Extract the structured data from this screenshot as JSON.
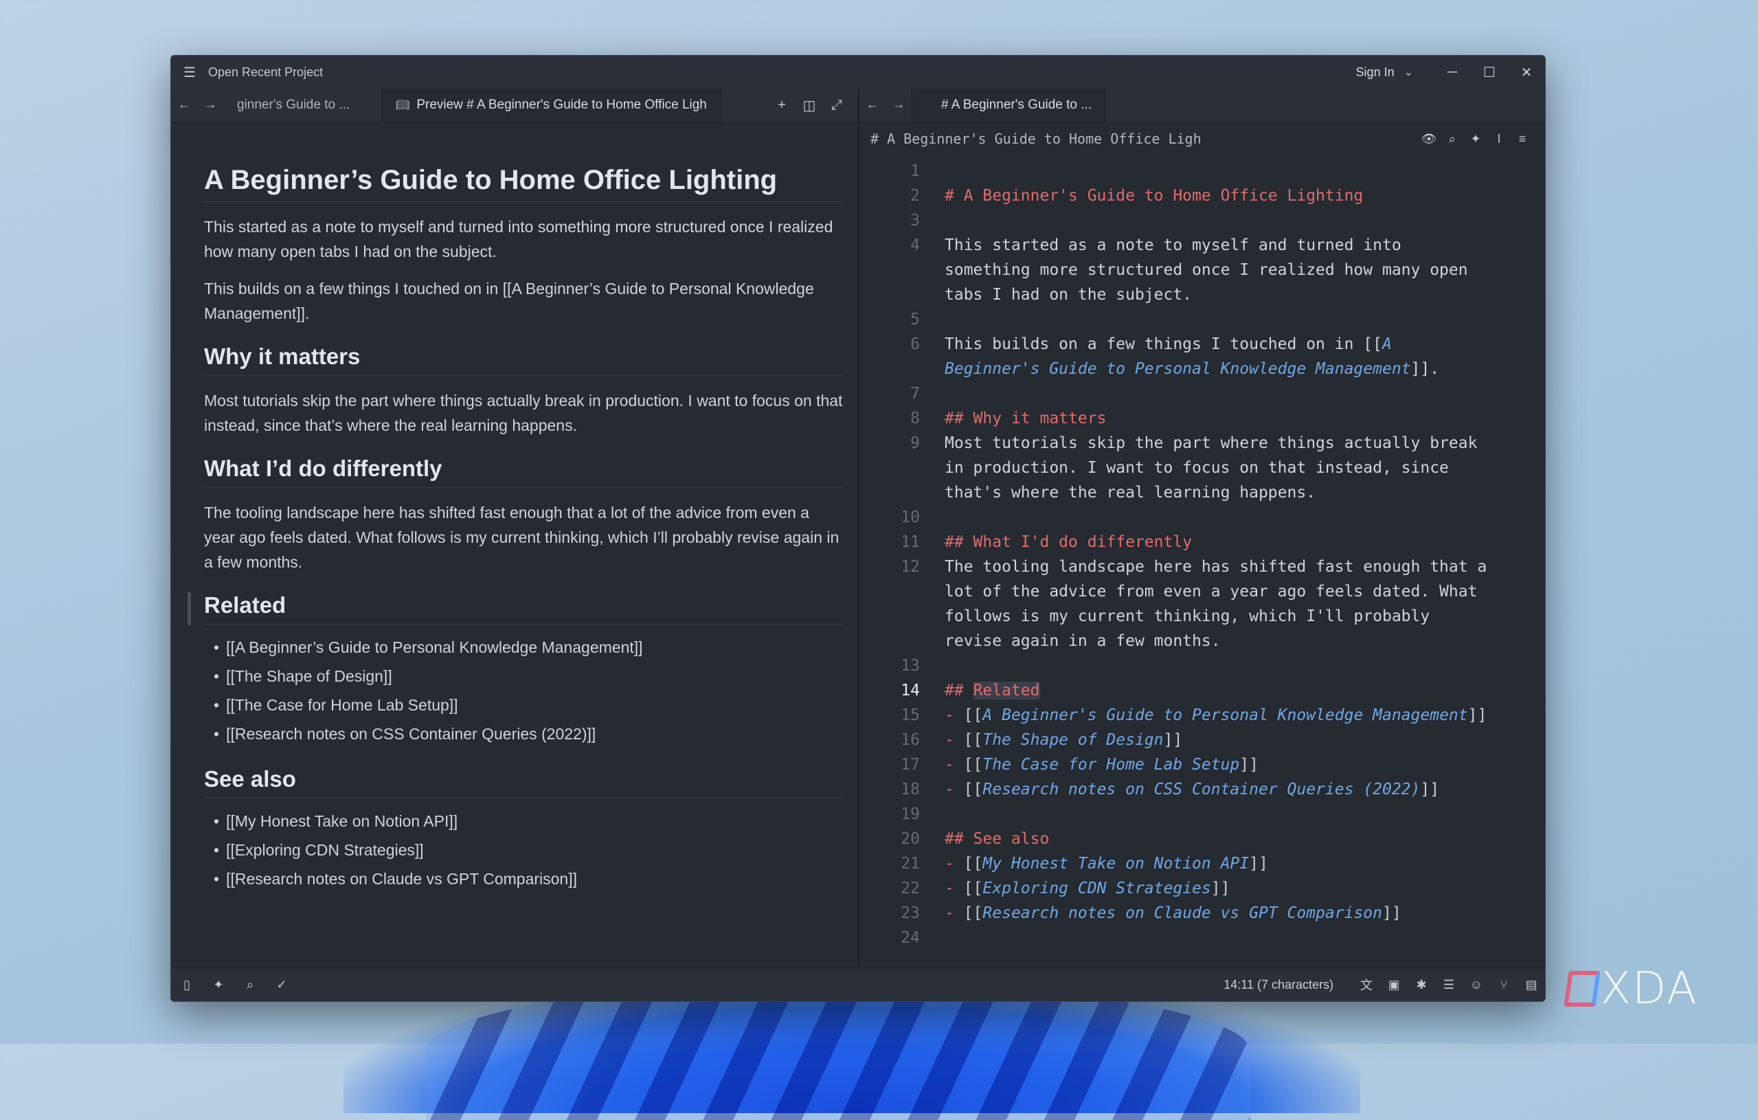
{
  "titlebar": {
    "menu_icon": "hamburger-menu-icon",
    "title": "Open Recent Project",
    "sign_in": "Sign In"
  },
  "left_tabs": {
    "inactive_tab": "ginner's Guide to ...",
    "active_tab": "Preview # A Beginner's Guide to Home Office Ligh"
  },
  "right_tabs": {
    "active_tab": "# A Beginner's Guide to ..."
  },
  "editor_header": {
    "title": "# A Beginner's Guide to Home Office Ligh"
  },
  "preview": {
    "h1": "A Beginner’s Guide to Home Office Lighting",
    "p1": "This started as a note to myself and turned into something more structured once I realized how many open tabs I had on the subject.",
    "p2": "This builds on a few things I touched on in [[A Beginner’s Guide to Personal Knowledge Management]].",
    "h2_why": "Why it matters",
    "p3": "Most tutorials skip the part where things actually break in production. I want to focus on that instead, since that’s where the real learning happens.",
    "h2_diff": "What I’d do differently",
    "p4": "The tooling landscape here has shifted fast enough that a lot of the advice from even a year ago feels dated. What follows is my current thinking, which I’ll probably revise again in a few months.",
    "h2_related": "Related",
    "related": [
      "[[A Beginner’s Guide to Personal Knowledge Management]]",
      "[[The Shape of Design]]",
      "[[The Case for Home Lab Setup]]",
      "[[Research notes on CSS Container Queries (2022)]]"
    ],
    "h2_see": "See also",
    "see_also": [
      "[[My Honest Take on Notion API]]",
      "[[Exploring CDN Strategies]]",
      "[[Research notes on Claude vs GPT Comparison]]"
    ]
  },
  "editor": {
    "line_numbers": [
      "1",
      "2",
      "3",
      "4",
      "5",
      "6",
      "7",
      "8",
      "9",
      "10",
      "11",
      "12",
      "13",
      "14",
      "15",
      "16",
      "17",
      "18",
      "19",
      "20",
      "21",
      "22",
      "23",
      "24"
    ],
    "current_line": "14",
    "l2": "# A Beginner's Guide to Home Office Lighting",
    "l4": "This started as a note to myself and turned into something more structured once I realized how many open tabs I had on the subject.",
    "l6_text": "This builds on a few things I touched on in [[",
    "l6_link": "A Beginner's Guide to Personal Knowledge Management",
    "l6_end": "]].",
    "l8_mark": "##",
    "l8_text": " Why it matters",
    "l9": "Most tutorials skip the part where things actually break in production. I want to focus on that instead, since that's where the real learning happens.",
    "l11_mark": "##",
    "l11_text": " What I'd do differently",
    "l12": "The tooling landscape here has shifted fast enough that a lot of the advice from even a year ago feels dated. What follows is my current thinking, which I'll probably revise again in a few months.",
    "l14_mark": "##",
    "l14_text": "Related",
    "related_links": [
      "A Beginner's Guide to Personal Knowledge Management",
      "The Shape of Design",
      "The Case for Home Lab Setup",
      "Research notes on CSS Container Queries (2022)"
    ],
    "l20_mark": "##",
    "l20_text": " See also",
    "see_links": [
      "My Honest Take on Notion API",
      "Exploring CDN Strategies",
      "Research notes on Claude vs GPT Comparison"
    ]
  },
  "statusbar": {
    "position": "14:11 (7 characters)"
  },
  "watermark": {
    "text": "XDA"
  },
  "colors": {
    "heading_red": "#e06c6c",
    "link_blue": "#6fa8e6",
    "background": "#262a31"
  }
}
